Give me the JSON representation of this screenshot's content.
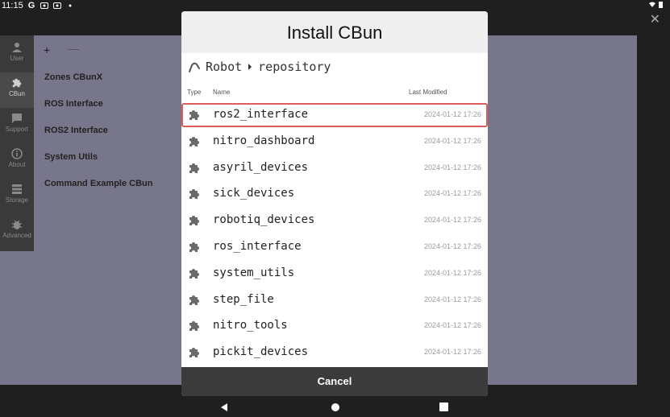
{
  "status": {
    "time": "11:15"
  },
  "sidebar": {
    "items": [
      {
        "label": "User",
        "icon": "user-icon"
      },
      {
        "label": "CBun",
        "icon": "puzzle-icon"
      },
      {
        "label": "Support",
        "icon": "chat-icon"
      },
      {
        "label": "About",
        "icon": "info-icon"
      },
      {
        "label": "Storage",
        "icon": "storage-icon"
      },
      {
        "label": "Advanced",
        "icon": "bug-icon"
      }
    ]
  },
  "list": {
    "add_label": "+",
    "remove_label": "—",
    "items": [
      "Zones CBunX",
      "ROS Interface",
      "ROS2 Interface",
      "System Utils",
      "Command Example CBun"
    ]
  },
  "dialog": {
    "title": "Install CBun",
    "breadcrumb": {
      "root": "Robot",
      "current": "repository"
    },
    "columns": {
      "type": "Type",
      "name": "Name",
      "modified": "Last Modified"
    },
    "files": [
      {
        "name": "ros2_interface",
        "date": "2024-01-12 17:26"
      },
      {
        "name": "nitro_dashboard",
        "date": "2024-01-12 17:26"
      },
      {
        "name": "asyril_devices",
        "date": "2024-01-12 17:26"
      },
      {
        "name": "sick_devices",
        "date": "2024-01-12 17:26"
      },
      {
        "name": "robotiq_devices",
        "date": "2024-01-12 17:26"
      },
      {
        "name": "ros_interface",
        "date": "2024-01-12 17:26"
      },
      {
        "name": "system_utils",
        "date": "2024-01-12 17:26"
      },
      {
        "name": "step_file",
        "date": "2024-01-12 17:26"
      },
      {
        "name": "nitro_tools",
        "date": "2024-01-12 17:26"
      },
      {
        "name": "pickit_devices",
        "date": "2024-01-12 17:26"
      }
    ],
    "selected_index": 0,
    "cancel_label": "Cancel"
  },
  "colors": {
    "accent": "#e05b5b",
    "dialog_bg": "#ffffff",
    "backdrop": "#77768a"
  }
}
